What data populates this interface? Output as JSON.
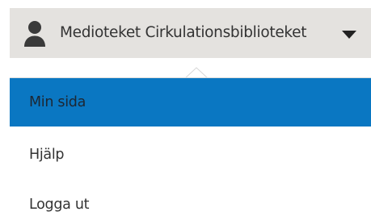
{
  "user_menu": {
    "toggle_label": "Medioteket Cirkulationsbiblioteket",
    "user_icon": "user-icon",
    "caret_icon": "caret-down-icon"
  },
  "dropdown": {
    "items": [
      {
        "label": "Min sida",
        "active": true
      },
      {
        "label": "Hjälp",
        "active": false
      },
      {
        "label": "Logga ut",
        "active": false
      }
    ]
  },
  "colors": {
    "toggle_background": "#e4e2df",
    "active_item": "#0a77c2",
    "text": "#333333",
    "icon": "#3a3a3a"
  }
}
